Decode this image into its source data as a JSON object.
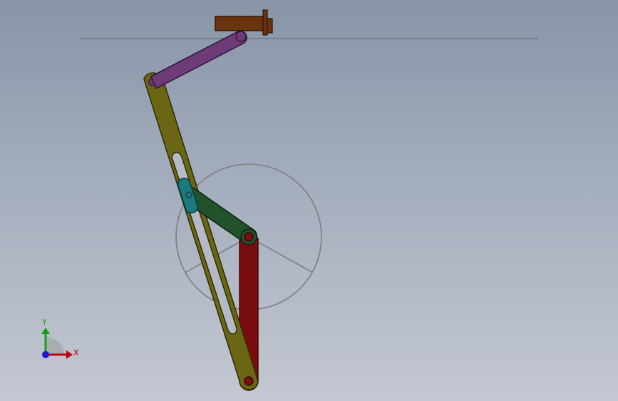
{
  "viewport": {
    "background_top": "#8795a6",
    "background_bottom": "#c3c8d2"
  },
  "triad": {
    "x_label": "X",
    "y_label": "Y",
    "x_color": "#c0000c",
    "y_color": "#15a015",
    "z_color": "#1a1acc"
  },
  "parts": {
    "slide_block": {
      "color": "#6b3410"
    },
    "connecting_rod": {
      "color": "#6e3b78"
    },
    "slotted_lever": {
      "color": "#6b6614"
    },
    "slider": {
      "color": "#1a7a7e"
    },
    "crank": {
      "color": "#22522a"
    },
    "frame_link": {
      "color": "#7a0d10"
    },
    "crank_circle": {
      "color": "#7f7f7f"
    }
  }
}
